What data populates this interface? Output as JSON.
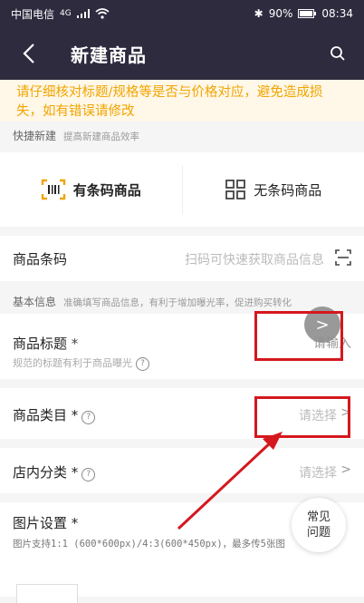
{
  "status": {
    "carrier": "中国电信",
    "signal": "4G",
    "battery": "90%",
    "time": "08:34"
  },
  "header": {
    "title": "新建商品"
  },
  "notice": "请仔细核对标题/规格等是否与价格对应，避免造成损失，如有错误请修改",
  "quick_create": {
    "label": "快捷新建",
    "hint": "提高新建商品效率",
    "options": [
      {
        "label": "有条码商品",
        "icon": "barcode-scan-icon",
        "active": true
      },
      {
        "label": "无条码商品",
        "icon": "grid-icon",
        "active": false
      }
    ]
  },
  "barcode": {
    "label": "商品条码",
    "placeholder": "扫码可快速获取商品信息"
  },
  "basic_info": {
    "label": "基本信息",
    "hint": "准确填写商品信息，有利于增加曝光率，促进购买转化"
  },
  "fields": {
    "title": {
      "label": "商品标题",
      "required": "*",
      "placeholder": "请输入",
      "tip": "规范的标题有利于商品曝光"
    },
    "category": {
      "label": "商品类目",
      "required": "*",
      "placeholder": "请选择"
    },
    "store_category": {
      "label": "店内分类",
      "required": "*",
      "placeholder": "请选择"
    },
    "images": {
      "label": "图片设置",
      "required": "*",
      "tip": "图片支持1:1 (600*600px)/4:3(600*450px)，最多传5张图"
    }
  },
  "faq": {
    "line1": "常见",
    "line2": "问题"
  },
  "colors": {
    "appbar": "#2e2b3f",
    "notice_text": "#f0a500",
    "annotation_red": "#d4181e"
  }
}
